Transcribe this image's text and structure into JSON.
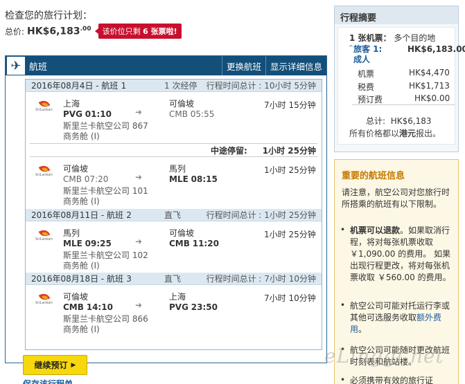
{
  "page": {
    "title": "检查您的旅行计划：",
    "total_label": "总价:",
    "total_price": "HK$6,183",
    "total_cents": ".00",
    "seats_prefix": "该价位只剩",
    "seats_count": "6 张票啦!"
  },
  "flights": {
    "header_title": "航班",
    "change_label": "更换航班",
    "details_label": "显示详细信息",
    "legs": [
      {
        "date": "2016年08月4日 - 航班",
        "num": "1",
        "stops": "1 次经停",
        "total": "行程时间总计 : 10小时 5分钟",
        "segments": [
          {
            "from_city": "上海",
            "from_code": "PVG",
            "from_time": "01:10",
            "to_city": "可倫坡",
            "to_code": "CMB",
            "to_time": "05:55",
            "duration": "7小时 15分钟",
            "airline": "斯里兰卡航空公司 867",
            "cabin": "商务舱 (I)"
          },
          {
            "from_city": "可倫坡",
            "from_code": "CMB",
            "from_time": "07:20",
            "to_city": "馬列",
            "to_code": "MLE",
            "to_time": "08:15",
            "duration": "1小时 25分钟",
            "airline": "斯里兰卡航空公司 101",
            "cabin": "商务舱 (I)"
          }
        ],
        "layover_label": "中途停留:",
        "layover_value": "1小时 25分钟"
      },
      {
        "date": "2016年08月11日 - 航班",
        "num": "2",
        "stops": "直飞",
        "total": "行程时间总计 : 1小时 25分钟",
        "segments": [
          {
            "from_city": "馬列",
            "from_code": "MLE",
            "from_time": "09:25",
            "to_city": "可倫坡",
            "to_code": "CMB",
            "to_time": "11:20",
            "duration": "1小时 25分钟",
            "airline": "斯里兰卡航空公司 102",
            "cabin": "商务舱 (I)"
          }
        ]
      },
      {
        "date": "2016年08月18日 - 航班",
        "num": "3",
        "stops": "直飞",
        "total": "行程时间总计 : 7小时 10分钟",
        "segments": [
          {
            "from_city": "可倫坡",
            "from_code": "CMB",
            "from_time": "14:10",
            "to_city": "上海",
            "to_code": "PVG",
            "to_time": "23:50",
            "duration": "7小时 10分钟",
            "airline": "斯里兰卡航空公司 866",
            "cabin": "商务舱 (I)"
          }
        ]
      }
    ],
    "airline_logo_text": "SriLankan"
  },
  "actions": {
    "continue_label": "继续预订",
    "save_label": "保存该行程单"
  },
  "summary": {
    "title": "行程摘要",
    "ticket_count": "1 张机票：",
    "ticket_type": "多个目的地",
    "passenger": "旅客 1: 成人",
    "passenger_amount": "HK$6,183.00",
    "rows": [
      {
        "label": "机票",
        "value": "HK$4,470"
      },
      {
        "label": "税费",
        "value": "HK$1,713"
      },
      {
        "label": "预订费",
        "value": "HK$0.00"
      }
    ],
    "total_label": "总计:",
    "total_value": "HK$6,183",
    "note_prefix": "所有价格都以",
    "note_currency": "港元",
    "note_suffix": "报出。"
  },
  "important": {
    "title": "重要的航班信息",
    "intro": "请注意，航空公司对您旅行时所搭乘的航班有以下限制。",
    "item1_bold": "机票可以退款",
    "item1_text": "。如果取消行程，将对每张机票收取￥1,090.00 的费用。 如果出现行程更改，将对每张机票收取 ￥560.00 的费用。",
    "item2_text": "航空公司可能对托运行李或其他可选服务收取",
    "item2_link": "额外费用",
    "item2_end": "。",
    "item3_text": "航空公司可能随时更改航班时刻表和航站楼。",
    "item4_text": "必须携带有效的旅行证"
  },
  "watermark": "eLinggi.net"
}
